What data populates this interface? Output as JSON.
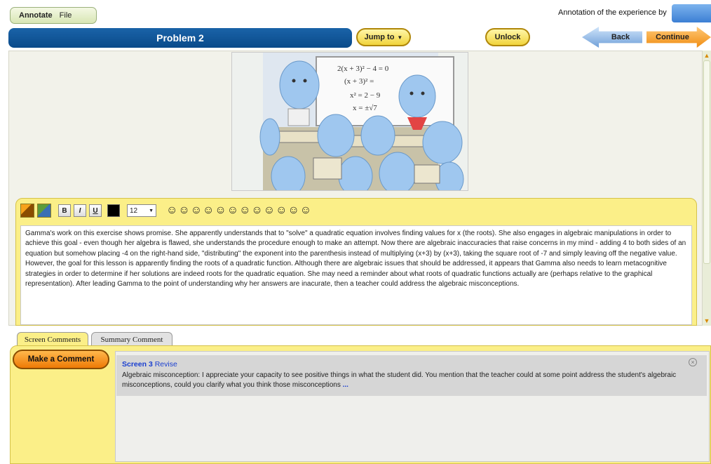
{
  "menu": {
    "annotate": "Annotate",
    "file": "File"
  },
  "header": {
    "annotation_by": "Annotation of the experience by",
    "problem_title": "Problem 2",
    "jump_to": "Jump to",
    "unlock": "Unlock",
    "back": "Back",
    "continue": "Continue"
  },
  "scene": {
    "board_lines": [
      "2(x + 3)² − 4 = 0",
      "(x + 3)² =",
      "x² = 2 − 9",
      "x = ±√7"
    ]
  },
  "editor": {
    "bold": "B",
    "italic": "I",
    "underline": "U",
    "font_size": "12",
    "smileys": [
      "☺",
      "☺",
      "☺",
      "☺",
      "☺",
      "☺",
      "☺",
      "☺",
      "☺",
      "☺",
      "☺",
      "☺"
    ],
    "text": "Gamma's work on this exercise shows promise. She apparently understands that to \"solve\" a quadratic equation involves finding values for x (the roots). She also engages in algebraic manipulations in order to achieve this goal - even though her algebra is flawed, she understands the procedure enough to make an attempt. Now there are algebraic inaccuracies that raise concerns in my mind - adding 4 to both sides of an equation but somehow placing -4 on the right-hand side, \"distributing\" the exponent into the parenthesis instead of multiplying (x+3) by (x+3), taking the square root of -7 and simply leaving off the negative value. However, the goal for this lesson is apparently finding the roots of a quadratic function. Although there are algebraic issues that should be addressed, it appears that Gamma also needs to learn metacognitive strategies in order to determine if her solutions are indeed roots for the quadratic equation. She may need a reminder about what roots of quadratic functions actually are (perhaps relative to the graphical representation). After leading Gamma to the point of understanding why her answers are inacurate, then a teacher could address the algebraic misconceptions."
  },
  "tabs": {
    "screen_comments": "Screen Comments",
    "summary_comment": "Summary Comment"
  },
  "comments": {
    "make_comment": "Make a Comment",
    "items": [
      {
        "screen": "Screen 3",
        "action": "Revise",
        "text": "Algebraic misconception: I appreciate your capacity to see positive things in what the student did. You mention that the teacher could at some point address the student's algebraic misconceptions, could you clarify what you think those misconceptions",
        "more": "..."
      }
    ]
  },
  "colors": {
    "title_blue": "#0a4a8a",
    "panel_yellow": "#fbef88",
    "accent_orange": "#f08c10",
    "link_blue": "#1a3fd0"
  }
}
